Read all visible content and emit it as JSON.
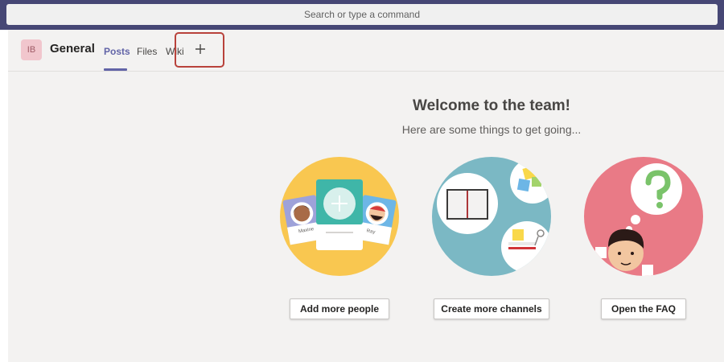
{
  "search": {
    "placeholder": "Search or type a command"
  },
  "channel": {
    "avatar_initials": "IB",
    "name": "General"
  },
  "tabs": [
    {
      "label": "Posts",
      "active": true
    },
    {
      "label": "Files",
      "active": false
    },
    {
      "label": "Wiki",
      "active": false
    }
  ],
  "add_tab_icon": "plus-icon",
  "welcome": {
    "title": "Welcome to the team!",
    "subtitle": "Here are some things to get going..."
  },
  "cards": [
    {
      "button": "Add more people",
      "icon": "people-illustration",
      "names": [
        "Maxine",
        "Ray"
      ]
    },
    {
      "button": "Create more channels",
      "icon": "channels-illustration"
    },
    {
      "button": "Open the FAQ",
      "icon": "faq-illustration"
    }
  ],
  "colors": {
    "brand": "#464775",
    "accent": "#6264a7",
    "highlight": "#b8423b",
    "people_bg": "#f9c750",
    "channels_bg": "#7bb8c4",
    "faq_bg": "#e97a86"
  }
}
